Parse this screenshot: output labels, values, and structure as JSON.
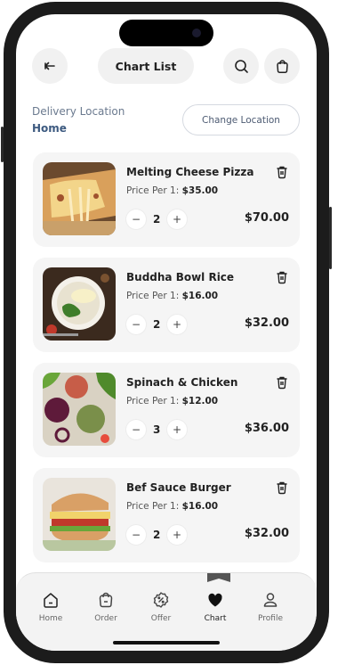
{
  "header": {
    "title": "Chart List",
    "back_icon": "arrow-left-icon",
    "search_icon": "search-icon",
    "bag_icon": "shopping-bag-icon"
  },
  "delivery": {
    "label": "Delivery Location",
    "value": "Home",
    "change_label": "Change Location"
  },
  "cart": {
    "price_per_label": "Price Per 1:",
    "items": [
      {
        "name": "Melting Cheese Pizza",
        "price": "$35.00",
        "quantity": "2",
        "total": "$70.00",
        "image": "cheese-pizza"
      },
      {
        "name": "Buddha Bowl Rice",
        "price": "$16.00",
        "quantity": "2",
        "total": "$32.00",
        "image": "rice-bowl"
      },
      {
        "name": "Spinach & Chicken",
        "price": "$12.00",
        "quantity": "3",
        "total": "$36.00",
        "image": "spinach-chicken"
      },
      {
        "name": "Bef Sauce Burger",
        "price": "$16.00",
        "quantity": "2",
        "total": "$32.00",
        "image": "burger"
      }
    ],
    "minus": "−",
    "plus": "+"
  },
  "tabbar": {
    "active": "Chart",
    "items": [
      {
        "label": "Home",
        "icon": "home-icon"
      },
      {
        "label": "Order",
        "icon": "bag-icon"
      },
      {
        "label": "Offer",
        "icon": "discount-badge-icon"
      },
      {
        "label": "Chart",
        "icon": "heart-icon"
      },
      {
        "label": "Profile",
        "icon": "user-icon"
      }
    ]
  },
  "colors": {
    "card_bg": "#f5f5f5",
    "location_value": "#3d5a80",
    "text": "#222222"
  }
}
